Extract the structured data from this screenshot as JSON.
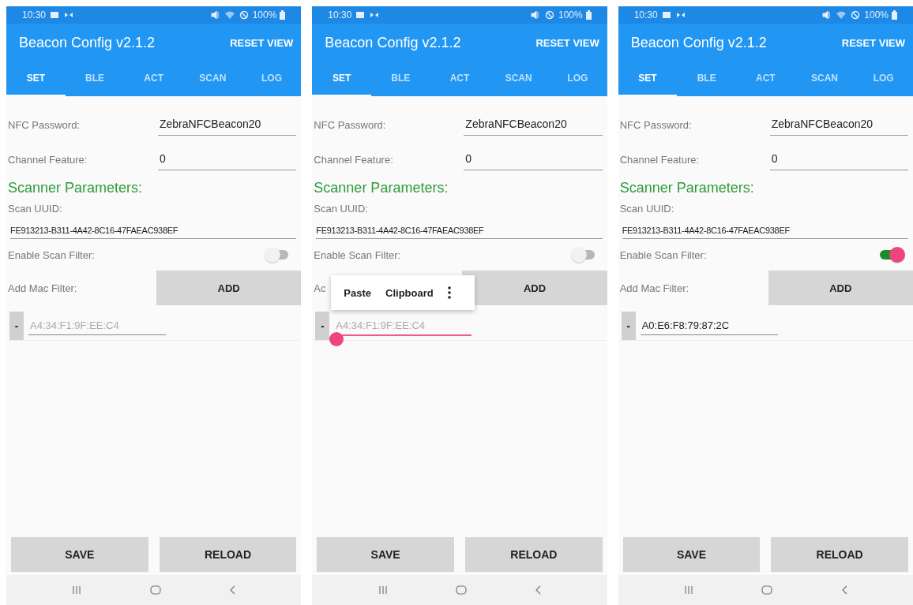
{
  "phones": [
    {
      "status_bar": {
        "time": "10:30",
        "wifi": true,
        "battery": "100%"
      },
      "title": "Beacon Config v2.1.2",
      "action": "RESET VIEW",
      "tabs": [
        {
          "label": "SET",
          "selected": true
        },
        {
          "label": "BLE",
          "selected": false
        },
        {
          "label": "ACT",
          "selected": false
        },
        {
          "label": "SCAN",
          "selected": false
        },
        {
          "label": "LOG",
          "selected": false
        }
      ],
      "fields": [
        {
          "label": "NFC Password:",
          "value": "ZebraNFCBeacon20"
        },
        {
          "label": "Channel Feature:",
          "value": "0"
        }
      ],
      "section_title": "Scanner Parameters:",
      "scan_uuid": {
        "label": "Scan UUID:",
        "value": "FE913213-B311-4A42-8C16-47FAEAC938EF"
      },
      "scan_filter": {
        "label": "Enable Scan Filter:",
        "on": false
      },
      "mac_filter": {
        "label": "Add Mac Filter:",
        "button": "ADD"
      },
      "mac_entries": [
        {
          "remove": "-",
          "placeholder": "A4:34:F1:9F:EE:C4",
          "focused": false
        }
      ],
      "buttons": [
        "SAVE",
        "RELOAD"
      ]
    },
    {
      "status_bar": {
        "time": "10:30",
        "wifi": false,
        "battery": "100%"
      },
      "title": "Beacon Config v2.1.2",
      "action": "RESET VIEW",
      "tabs": [
        {
          "label": "SET",
          "selected": true
        },
        {
          "label": "BLE",
          "selected": false
        },
        {
          "label": "ACT",
          "selected": false
        },
        {
          "label": "SCAN",
          "selected": false
        },
        {
          "label": "LOG",
          "selected": false
        }
      ],
      "fields": [
        {
          "label": "NFC Password:",
          "value": "ZebraNFCBeacon20"
        },
        {
          "label": "Channel Feature:",
          "value": "0"
        }
      ],
      "section_title": "Scanner Parameters:",
      "scan_uuid": {
        "label": "Scan UUID:",
        "value": "FE913213-B311-4A42-8C16-47FAEAC938EF"
      },
      "scan_filter": {
        "label": "Enable Scan Filter:",
        "on": false
      },
      "mac_filter": {
        "label": "Ac",
        "button": "ADD"
      },
      "mac_entries": [
        {
          "remove": "-",
          "placeholder": "A4:34:F1:9F:EE:C4",
          "focused": true
        }
      ],
      "popup": {
        "items": [
          "Paste",
          "Clipboard"
        ]
      },
      "buttons": [
        "SAVE",
        "RELOAD"
      ]
    },
    {
      "status_bar": {
        "time": "10:30",
        "wifi": true,
        "battery": "100%"
      },
      "title": "Beacon Config v2.1.2",
      "action": "RESET VIEW",
      "tabs": [
        {
          "label": "SET",
          "selected": true
        },
        {
          "label": "BLE",
          "selected": false
        },
        {
          "label": "ACT",
          "selected": false
        },
        {
          "label": "SCAN",
          "selected": false
        },
        {
          "label": "LOG",
          "selected": false
        }
      ],
      "fields": [
        {
          "label": "NFC Password:",
          "value": "ZebraNFCBeacon20"
        },
        {
          "label": "Channel Feature:",
          "value": "0"
        }
      ],
      "section_title": "Scanner Parameters:",
      "scan_uuid": {
        "label": "Scan UUID:",
        "value": "FE913213-B311-4A42-8C16-47FAEAC938EF"
      },
      "scan_filter": {
        "label": "Enable Scan Filter:",
        "on": true
      },
      "mac_filter": {
        "label": "Add Mac Filter:",
        "button": "ADD"
      },
      "mac_entries": [
        {
          "remove": "-",
          "value": "A0:E6:F8:79:87:2C",
          "focused": false
        }
      ],
      "buttons": [
        "SAVE",
        "RELOAD"
      ]
    }
  ]
}
